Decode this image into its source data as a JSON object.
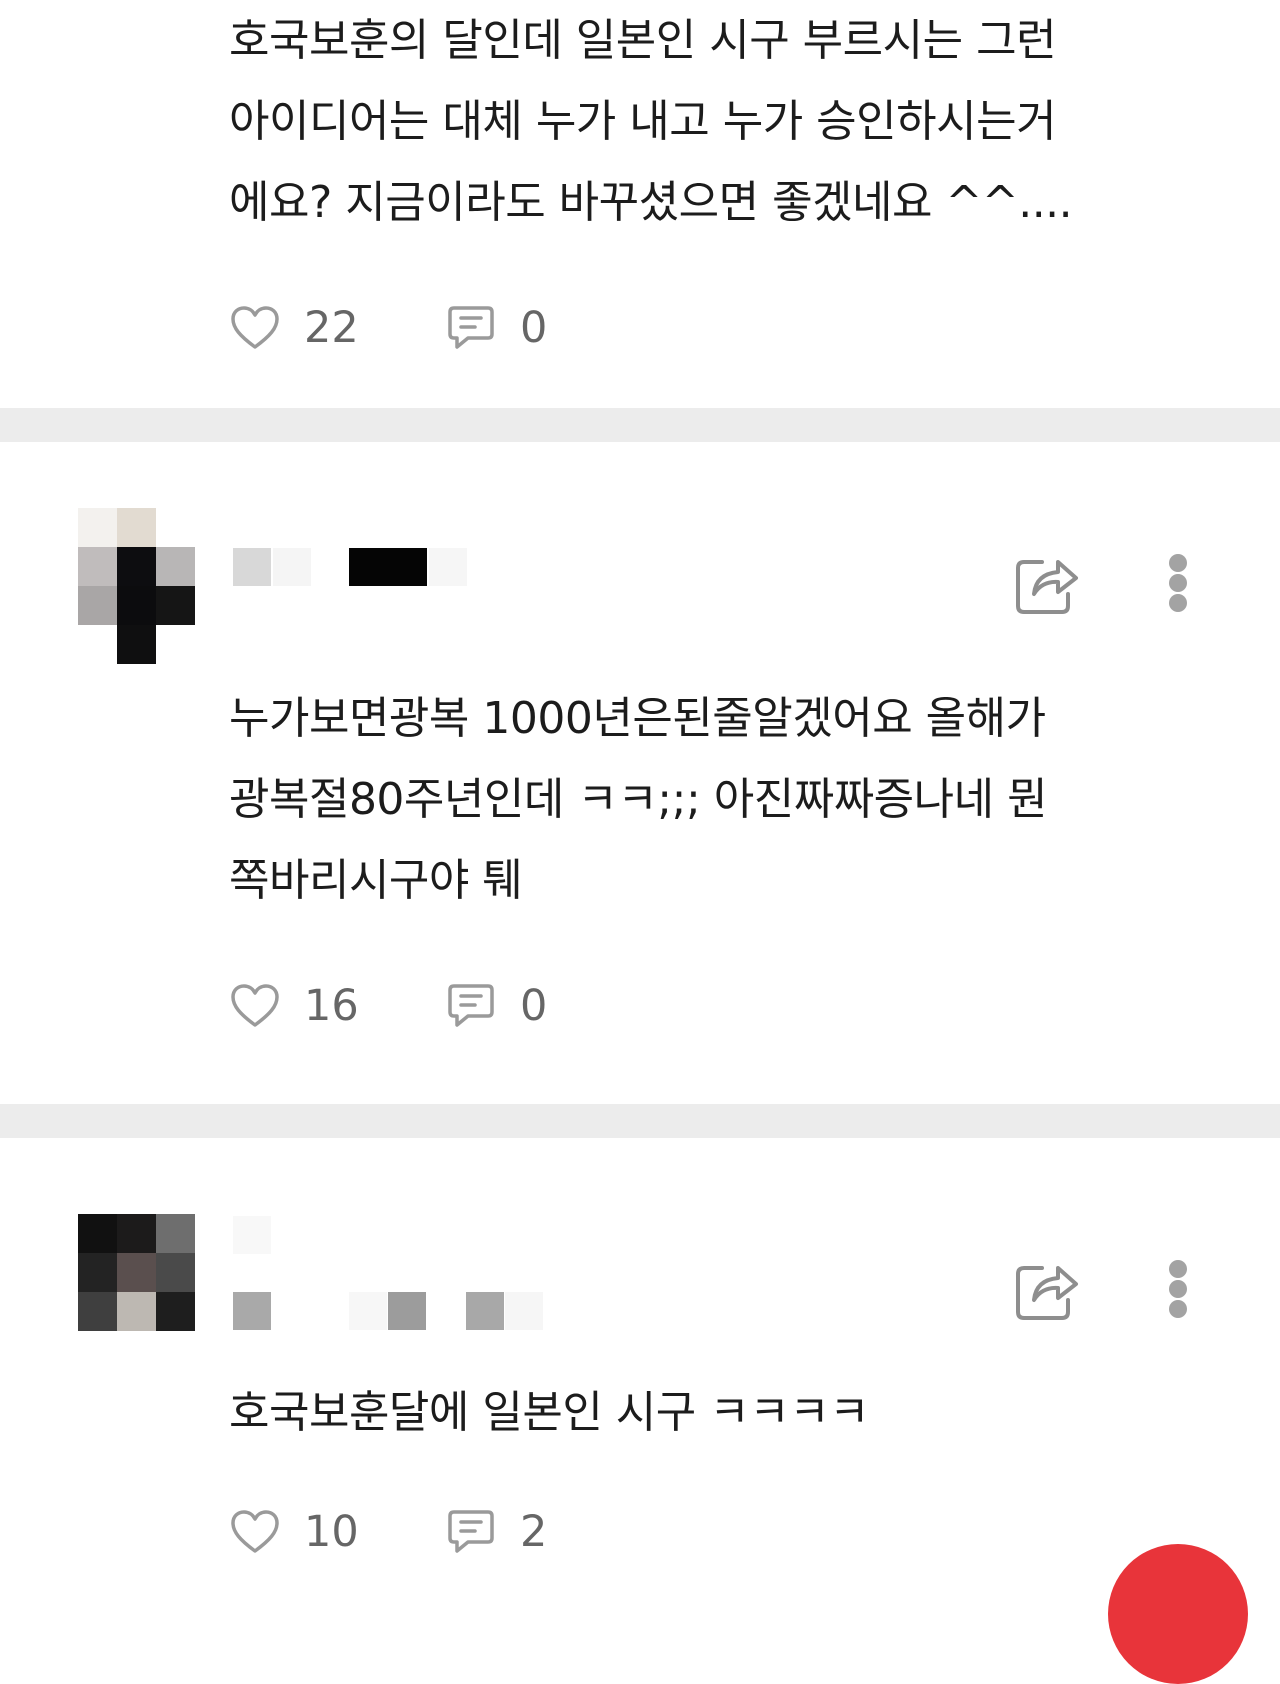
{
  "comments": [
    {
      "text": "호국보훈의 달인데 일본인 시구 부르시는 그런\n아이디어는 대체 누가 내고 누가 승인하시는거\n에요? 지금이라도 바꾸셨으면 좋겠네요 ^^....",
      "likes": "22",
      "replies": "0"
    },
    {
      "text": "누가보면광복 1000년은된줄알겠어요 올해가\n광복절80주년인데 ㅋㅋ;;; 아진짜짜증나네 뭔\n쪽바리시구야 퉤",
      "likes": "16",
      "replies": "0"
    },
    {
      "text": "호국보훈달에 일본인 시구 ㅋㅋㅋㅋ",
      "likes": "10",
      "replies": "2"
    }
  ],
  "icons": {
    "like": "heart-outline-icon",
    "reply": "speech-bubble-icon",
    "share": "share-arrow-icon",
    "more": "vertical-ellipsis-icon"
  },
  "colors": {
    "icon_gray": "#9a9a9a",
    "count_gray": "#666666",
    "divider": "#ececec",
    "fab_red": "#e8343a"
  }
}
